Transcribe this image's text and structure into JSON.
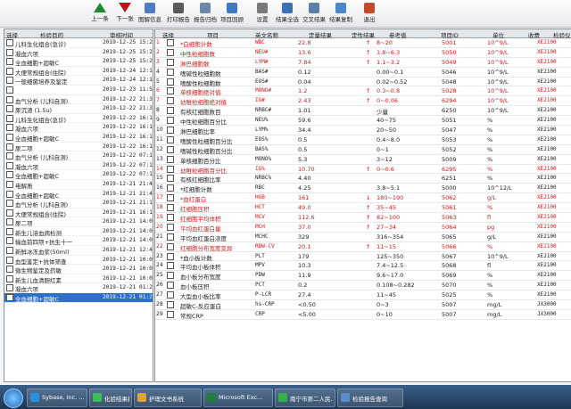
{
  "toolbar": {
    "buttons": [
      {
        "label": "上一条",
        "icon": "up-arrow-icon",
        "color": "#1c8a2a"
      },
      {
        "label": "下一张",
        "icon": "down-arrow-icon",
        "color": "#c4121b"
      },
      {
        "label": "图解信息",
        "icon": "chart-icon",
        "color": "#4b7cc4"
      },
      {
        "label": "打印报告",
        "icon": "printer-icon",
        "color": "#5a5a5a"
      },
      {
        "label": "报告归档",
        "icon": "archive-icon",
        "color": "#6a8aa8"
      },
      {
        "label": "项目回顾",
        "icon": "review-icon",
        "color": "#3f79c6"
      },
      {
        "label": "设置",
        "icon": "settings-icon",
        "color": "#7a7a7a"
      },
      {
        "label": "结果全选",
        "icon": "select-all-icon",
        "color": "#3d6fb8"
      },
      {
        "label": "交叉结果",
        "icon": "cross-icon",
        "color": "#5b7fa6"
      },
      {
        "label": "结果复制",
        "icon": "copy-icon",
        "color": "#4c86c9"
      },
      {
        "label": "退出",
        "icon": "exit-icon",
        "color": "#c24a2a"
      }
    ]
  },
  "left_panel": {
    "headers": {
      "select": "选择",
      "name": "检验目的",
      "date": "审核时间"
    },
    "rows": [
      {
        "name": "儿科生化组合(急诊)",
        "date": "2019-12-25 15:25"
      },
      {
        "name": "凝血六项",
        "date": "2019-12-25 15:25"
      },
      {
        "name": "全血细胞+超敏C",
        "date": "2019-12-25 15:25"
      },
      {
        "name": "大便常规组合(住院)",
        "date": "2019-12-24 12:12"
      },
      {
        "name": "一般细菌培养及鉴定",
        "date": "2019-12-24 12:12"
      },
      {
        "name": "",
        "date": "2019-12-23 11:50"
      },
      {
        "name": "血气分析 (儿科自测)",
        "date": "2019-12-22 21:35"
      },
      {
        "name": "尿沉渣 (1.5u)",
        "date": "2019-12-22 21:35"
      },
      {
        "name": "儿科生化组合(急诊)",
        "date": "2019-12-22 16:15"
      },
      {
        "name": "凝血六项",
        "date": "2019-12-22 16:15"
      },
      {
        "name": "全血细胞+超敏C",
        "date": "2019-12-22 16:15"
      },
      {
        "name": "尿二项",
        "date": "2019-12-22 16:15"
      },
      {
        "name": "血气分析 (儿科自测)",
        "date": "2019-12-22 07:10"
      },
      {
        "name": "凝血六项",
        "date": "2019-12-22 07:10"
      },
      {
        "name": "全血细胞+超敏C",
        "date": "2019-12-22 07:10"
      },
      {
        "name": "电解质",
        "date": "2019-12-21 21:42"
      },
      {
        "name": "全血细胞+超敏C",
        "date": "2019-12-21 21:42"
      },
      {
        "name": "血气分析 (儿科自测)",
        "date": "2019-12-21 21:10"
      },
      {
        "name": "大便常规组合(住院)",
        "date": "2019-12-21 16:10"
      },
      {
        "name": "尿二项",
        "date": "2019-12-21 14:07"
      },
      {
        "name": "新生儿溶血病检测",
        "date": "2019-12-21 14:07"
      },
      {
        "name": "输血前四项+抗生十一",
        "date": "2019-12-21 14:07"
      },
      {
        "name": "新鲜冰冻血浆(50ml)",
        "date": "2019-12-21 12:41"
      },
      {
        "name": "血型鉴定+抗体筛查",
        "date": "2019-12-21 10:04"
      },
      {
        "name": "微生物鉴定及药敏",
        "date": "2019-12-21 10:04"
      },
      {
        "name": "新生儿血清胆红素",
        "date": "2019-12-21 10:03"
      },
      {
        "name": "凝血六项",
        "date": "2019-12-21 01:21"
      },
      {
        "name": "全血细胞+超敏C",
        "date": "2019-12-21 01:22",
        "selected": true
      }
    ]
  },
  "grid": {
    "headers": {
      "select": "选择",
      "item": "项目",
      "en": "英文名称",
      "result": "定量结果",
      "flag": "定性结果",
      "ref": "参考值",
      "pid": "项目ID",
      "unit": "单位",
      "fee": "收费",
      "exam": "检验仪"
    },
    "rows": [
      {
        "no": "1",
        "item": "*白细胞计数",
        "en": "WBC",
        "result": "22.8",
        "flag": "↑",
        "ref": "8~20",
        "pid": "5001",
        "unit": "10^9/L",
        "fee": "XE2100",
        "red": true
      },
      {
        "no": "2",
        "item": "中性粒细胞数",
        "en": "NEU#",
        "result": "13.6",
        "flag": "↑",
        "ref": "1.8~6.3",
        "pid": "5050",
        "unit": "10^9/L",
        "fee": "XE2100",
        "red": true
      },
      {
        "no": "3",
        "item": "淋巴细胞数",
        "en": "LYM#",
        "result": "7.84",
        "flag": "↑",
        "ref": "1.1~3.2",
        "pid": "5049",
        "unit": "10^9/L",
        "fee": "XE2100",
        "red": true
      },
      {
        "no": "4",
        "item": "嗜碱性粒细胞数",
        "en": "BAS#",
        "result": "0.12",
        "flag": "",
        "ref": "0.00~0.1",
        "pid": "5046",
        "unit": "10^9/L",
        "fee": "XE2100",
        "red": false
      },
      {
        "no": "5",
        "item": "嗜酸性粒细胞数",
        "en": "EOS#",
        "result": "0.04",
        "flag": "",
        "ref": "0.02~0.52",
        "pid": "5048",
        "unit": "10^9/L",
        "fee": "XE2100",
        "red": false
      },
      {
        "no": "6",
        "item": "单核细胞绝对值",
        "en": "MONO#",
        "result": "1.2",
        "flag": "↑",
        "ref": "0.3~0.8",
        "pid": "5028",
        "unit": "10^9/L",
        "fee": "XE2100",
        "red": true
      },
      {
        "no": "7",
        "item": "幼稚粒细胞绝对值",
        "en": "IG#",
        "result": "2.43",
        "flag": "↑",
        "ref": "0~0.06",
        "pid": "6294",
        "unit": "10^9/L",
        "fee": "XE2100",
        "red": true
      },
      {
        "no": "8",
        "item": "有核红细胞数目",
        "en": "NRBC#",
        "result": "1.01",
        "flag": "",
        "ref": "少量",
        "pid": "6250",
        "unit": "10^9/L",
        "fee": "XE2100",
        "red": false
      },
      {
        "no": "9",
        "item": "中性粒细胞百分比",
        "en": "NEU%",
        "result": "59.6",
        "flag": "",
        "ref": "40~75",
        "pid": "5051",
        "unit": "%",
        "fee": "XE2100",
        "red": false
      },
      {
        "no": "10",
        "item": "淋巴细胞比率",
        "en": "LYM%",
        "result": "34.4",
        "flag": "",
        "ref": "20~50",
        "pid": "5047",
        "unit": "%",
        "fee": "XE2100",
        "red": false
      },
      {
        "no": "11",
        "item": "嗜酸性粒细胞百分比",
        "en": "EOS%",
        "result": "0.5",
        "flag": "",
        "ref": "0.4~8.0",
        "pid": "5053",
        "unit": "%",
        "fee": "XE2100",
        "red": false
      },
      {
        "no": "12",
        "item": "嗜碱性粒细胞百分比",
        "en": "BAS%",
        "result": "0.5",
        "flag": "",
        "ref": "0~1",
        "pid": "5052",
        "unit": "%",
        "fee": "XE2100",
        "red": false
      },
      {
        "no": "13",
        "item": "单核细胞百分比",
        "en": "MONO%",
        "result": "5.3",
        "flag": "",
        "ref": "3~12",
        "pid": "5009",
        "unit": "%",
        "fee": "XE2100",
        "red": false
      },
      {
        "no": "14",
        "item": "幼稚粒细胞百分比",
        "en": "IG%",
        "result": "10.70",
        "flag": "↑",
        "ref": "0~0.6",
        "pid": "6295",
        "unit": "%",
        "fee": "XE2100",
        "red": true
      },
      {
        "no": "15",
        "item": "有核红细胞比率",
        "en": "NRBC%",
        "result": "4.40",
        "flag": "",
        "ref": "",
        "pid": "6251",
        "unit": "%",
        "fee": "XE2100",
        "red": false
      },
      {
        "no": "16",
        "item": "*红细胞计数",
        "en": "RBC",
        "result": "4.25",
        "flag": "",
        "ref": "3.8~5.1",
        "pid": "5000",
        "unit": "10^12/L",
        "fee": "XE2100",
        "red": false
      },
      {
        "no": "17",
        "item": "*血红蛋白",
        "en": "HGB",
        "result": "161",
        "flag": "↓",
        "ref": "180~190",
        "pid": "5062",
        "unit": "g/L",
        "fee": "XE2100",
        "red": true
      },
      {
        "no": "18",
        "item": "红细胞压积",
        "en": "HCT",
        "result": "49.0",
        "flag": "↑",
        "ref": "35~45",
        "pid": "5061",
        "unit": "%",
        "fee": "XE2100",
        "red": true
      },
      {
        "no": "19",
        "item": "红细胞平均体积",
        "en": "MCV",
        "result": "112.6",
        "flag": "↑",
        "ref": "82~100",
        "pid": "5063",
        "unit": "fl",
        "fee": "XE2100",
        "red": true
      },
      {
        "no": "20",
        "item": "平均血红蛋白量",
        "en": "MCH",
        "result": "37.0",
        "flag": "↑",
        "ref": "27~34",
        "pid": "5064",
        "unit": "pg",
        "fee": "XE2100",
        "red": true
      },
      {
        "no": "21",
        "item": "平均血红蛋白浓度",
        "en": "MCHC",
        "result": "329",
        "flag": "",
        "ref": "316~354",
        "pid": "5065",
        "unit": "g/L",
        "fee": "XE2100",
        "red": false
      },
      {
        "no": "22",
        "item": "红细胞分布宽度变异",
        "en": "RDW-CV",
        "result": "20.1",
        "flag": "↑",
        "ref": "11~15",
        "pid": "5066",
        "unit": "%",
        "fee": "XE2100",
        "red": true
      },
      {
        "no": "23",
        "item": "*血小板计数",
        "en": "PLT",
        "result": "179",
        "flag": "",
        "ref": "125~350",
        "pid": "5067",
        "unit": "10^9/L",
        "fee": "XE2100",
        "red": false
      },
      {
        "no": "24",
        "item": "平均血小板体积",
        "en": "MPV",
        "result": "10.3",
        "flag": "",
        "ref": "7.4~12.5",
        "pid": "5068",
        "unit": "fl",
        "fee": "XE2100",
        "red": false
      },
      {
        "no": "25",
        "item": "血小板分布宽度",
        "en": "PDW",
        "result": "11.9",
        "flag": "",
        "ref": "9.6~17.0",
        "pid": "5069",
        "unit": "%",
        "fee": "XE2100",
        "red": false
      },
      {
        "no": "26",
        "item": "血小板压积",
        "en": "PCT",
        "result": "0.2",
        "flag": "",
        "ref": "0.108~0.282",
        "pid": "5070",
        "unit": "%",
        "fee": "XE2100",
        "red": false
      },
      {
        "no": "27",
        "item": "大型血小板比率",
        "en": "P-LCR",
        "result": "27.4",
        "flag": "",
        "ref": "11~45",
        "pid": "5025",
        "unit": "%",
        "fee": "XE2100",
        "red": false
      },
      {
        "no": "28",
        "item": "超敏C-反应蛋白",
        "en": "hs-CRP",
        "result": "<0.50",
        "flag": "",
        "ref": "0~3",
        "pid": "5007",
        "unit": "mg/L",
        "fee": "JX3000",
        "red": false
      },
      {
        "no": "29",
        "item": "常规CRP",
        "en": "CRP",
        "result": "<5.00",
        "flag": "",
        "ref": "0~10",
        "pid": "5007",
        "unit": "mg/L",
        "fee": "JX3000",
        "red": false
      }
    ]
  },
  "taskbar": {
    "items": [
      {
        "label": "Sybase, Inc. ...",
        "color": "#2a8fdf"
      },
      {
        "label": "化验结果报告",
        "color": "#3dbd5a"
      },
      {
        "label": "护理文书系统",
        "color": "#e0a33a"
      },
      {
        "label": "Microsoft Exc...",
        "color": "#1f7f3f"
      },
      {
        "label": "南宁市第二人民...",
        "color": "#38b04a"
      },
      {
        "label": "检验报告查询",
        "color": "#5b8bd0"
      }
    ]
  }
}
